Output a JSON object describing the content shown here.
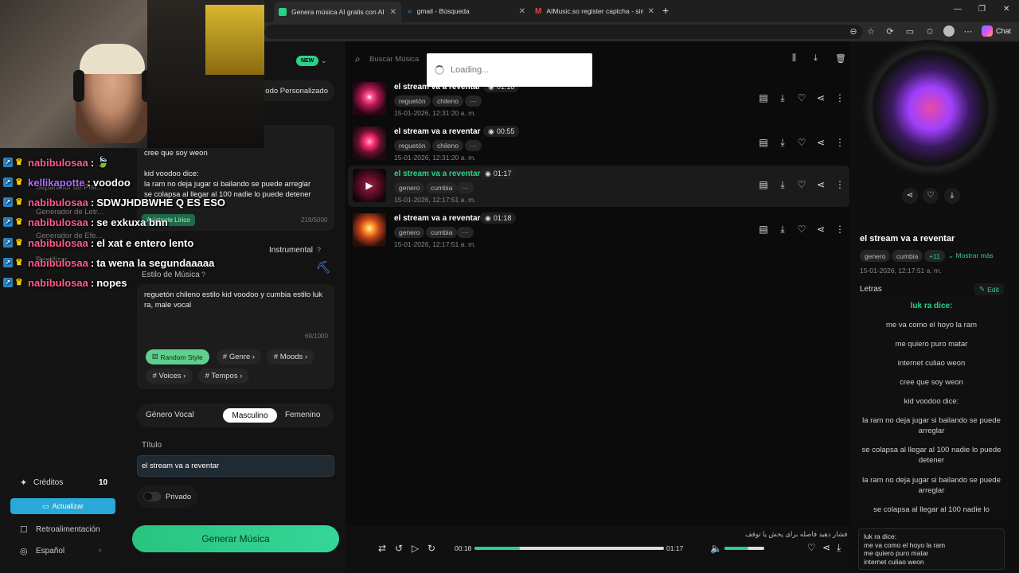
{
  "browser": {
    "tabs": [
      {
        "label": "Genera música AI gratis con AI Mu",
        "active": true
      },
      {
        "label": "gmail - Búsqueda",
        "active": false
      },
      {
        "label": "AIMusic.so register captcha - simo",
        "active": false
      }
    ],
    "copilot_label": "Chat"
  },
  "left": {
    "new_badge": "NEW",
    "mode_label": "odo Personalizado",
    "ghost_items": [
      "Separador de Pist...",
      "Generador de Letr...",
      "Generador de Efe...",
      "Reutilizar..."
    ],
    "credits_label": "Créditos",
    "credits_value": "10",
    "upgrade_label": "Actualizar",
    "feedback_label": "Retroalimentación",
    "language_label": "Español"
  },
  "form": {
    "lyrics_lines": [
      "cree que soy weon",
      "",
      "kid voodoo dice:",
      "la ram no deja jugar si bailando se puede arreglar",
      "se colapsa al llegar al 100 nadie lo puede detener"
    ],
    "lyrics_button": "Asistente Lírico",
    "lyrics_count": "219/5000",
    "instrumental_label": "Instrumental",
    "style_label": "Estilo de Música",
    "style_text": "reguetón chileno estilo kid voodoo y cumbia estilo luk ra, male vocal",
    "style_count": "69/1000",
    "random_style": "Random Style",
    "chips": [
      "# Genre",
      "# Moods",
      "# Voices",
      "# Tempos"
    ],
    "vocal_label": "Género Vocal",
    "vocal_options": [
      "Masculino",
      "Femenino"
    ],
    "title_label": "Título",
    "title_value": "el stream va a reventar",
    "private_label": "Privado",
    "generate_label": "Generar Música"
  },
  "search": {
    "placeholder": "Buscar Música",
    "loading": "Loading..."
  },
  "songs": [
    {
      "title": "el stream va a reventar",
      "duration": "01:18",
      "tags": [
        "reguetón",
        "chileno",
        "···"
      ],
      "date": "15-01-2026, 12:31:20 a. m."
    },
    {
      "title": "el stream va a reventar",
      "duration": "00:55",
      "tags": [
        "reguetón",
        "chileno",
        "···"
      ],
      "date": "15-01-2026, 12:31:20 a. m."
    },
    {
      "title": "el stream va a reventar",
      "duration": "01:17",
      "tags": [
        "genero",
        "cumbia",
        "···"
      ],
      "date": "15-01-2026, 12:17:51 a. m."
    },
    {
      "title": "el stream va a reventar",
      "duration": "01:18",
      "tags": [
        "genero",
        "cumbia",
        "···"
      ],
      "date": "15-01-2026, 12:17:51 a. m."
    }
  ],
  "player": {
    "current": "00:18",
    "total": "01:17",
    "progress": 0.24,
    "volume": 0.6,
    "hint": "فشار دهید فاصله برای پخش یا توقف"
  },
  "right": {
    "title": "el stream va a reventar",
    "tags": [
      "genero",
      "cumbia",
      "+11"
    ],
    "show_more": "Mostrar más",
    "date": "15-01-2026, 12:17:51 a. m.",
    "lyrics_label": "Letras",
    "edit_label": "Edit",
    "lyrics_head": "luk ra dice:",
    "lyrics": [
      "me va como el hoyo la ram",
      "me quiero puro matar",
      "internet culiao weon",
      "cree que soy weon",
      "kid voodoo dice:",
      "la ram no deja jugar si bailando se puede arreglar",
      "se colapsa al llegar al 100 nadie lo puede detener",
      "la ram no deja jugar si bailando se puede arreglar",
      "se colapsa al llegar al 100 nadie lo"
    ],
    "mini_lyrics": [
      "luk ra dice:",
      "me va como el hoyo la ram",
      "me quiero puro matar",
      "internet culiao weon"
    ]
  },
  "stream_chat": [
    {
      "user": "nabibulosaa",
      "color": "#ff5c8a",
      "msg": "🍃"
    },
    {
      "user": "kellikapotte",
      "color": "#b06bff",
      "msg": "voodoo"
    },
    {
      "user": "nabibulosaa",
      "color": "#ff5c8a",
      "msg": "SDWJHDBWHE Q ES ESO"
    },
    {
      "user": "nabibulosaa",
      "color": "#ff5c8a",
      "msg": "se exkuxa bnn"
    },
    {
      "user": "nabibulosaa",
      "color": "#ff5c8a",
      "msg": "el xat e entero lento"
    },
    {
      "user": "nabibulosaa",
      "color": "#ff5c8a",
      "msg": "ta wena la segundaaaaa"
    },
    {
      "user": "nabibulosaa",
      "color": "#ff5c8a",
      "msg": "nopes"
    }
  ],
  "colors": {
    "accent": "#2bd08a",
    "bg": "#0d0d0d"
  }
}
